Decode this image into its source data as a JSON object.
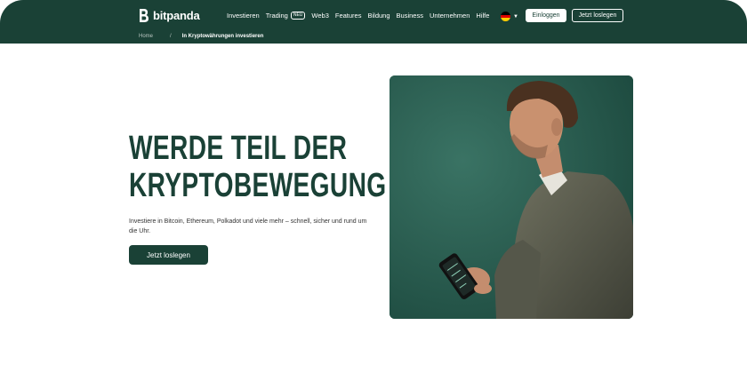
{
  "brand": {
    "name": "bitpanda",
    "color": "#1a4136"
  },
  "nav": {
    "items": [
      {
        "label": "Investieren"
      },
      {
        "label": "Trading",
        "badge": "NEU"
      },
      {
        "label": "Web3"
      },
      {
        "label": "Features"
      },
      {
        "label": "Bildung"
      },
      {
        "label": "Business"
      },
      {
        "label": "Unternehmen"
      },
      {
        "label": "Hilfe"
      }
    ],
    "language_icon": "german-flag-icon",
    "login_label": "Einloggen",
    "start_label": "Jetzt loslegen"
  },
  "breadcrumb": {
    "home": "Home",
    "separator": "/",
    "current": "In Kryptowährungen investieren"
  },
  "hero": {
    "title_line1": "WERDE TEIL DER",
    "title_line2": "KRYPTOBEWEGUNG",
    "subtitle": "Investiere in Bitcoin, Ethereum, Polkadot und viele mehr – schnell, sicher und rund um die Uhr.",
    "cta_label": "Jetzt loslegen"
  }
}
